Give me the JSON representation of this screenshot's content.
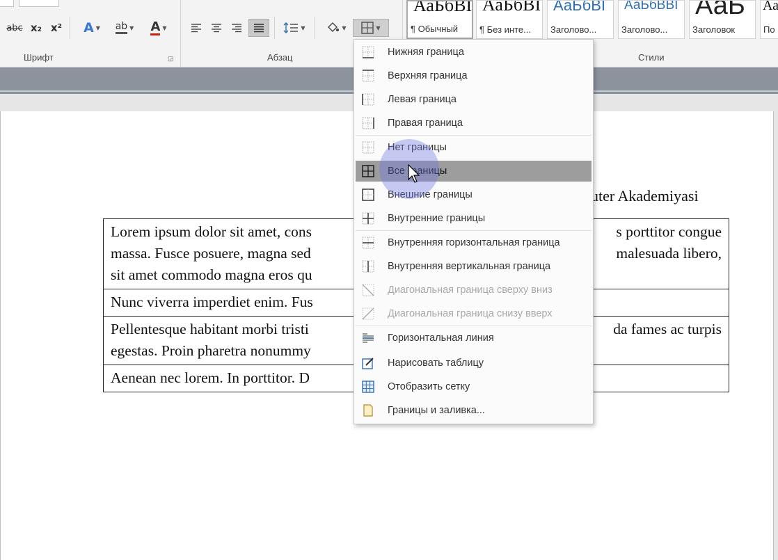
{
  "ribbon": {
    "font_group_label": "Шрифт",
    "paragraph_group_label": "Абзац",
    "styles_group_label": "Стили",
    "tools": {
      "strike": "abc",
      "subscript": "x₂",
      "superscript": "x²",
      "text_effects": "A",
      "highlight": "ab",
      "font_color": "A"
    }
  },
  "styles": [
    {
      "preview": "АаБбВІ",
      "name": "¶ Обычный"
    },
    {
      "preview": "АаБбВІ",
      "name": "¶ Без инте..."
    },
    {
      "preview": "АаБбВІ",
      "name": "Заголово..."
    },
    {
      "preview": "АаБбВВІ",
      "name": "Заголово..."
    },
    {
      "preview": "АаБ",
      "name": "Заголовок"
    },
    {
      "preview": "Аа",
      "name": "По"
    }
  ],
  "document": {
    "header_text": "uter Akademiyasi",
    "rows": [
      {
        "left": "Lorem ipsum dolor sit amet, cons",
        "right": "s porttitor congue",
        "left2": "massa. Fusce posuere, magna sed",
        "right2": "malesuada libero,",
        "left3": "sit amet commodo magna eros qu",
        "right3": ""
      },
      {
        "left": "Nunc viverra imperdiet enim. Fus",
        "right": ""
      },
      {
        "left": "Pellentesque habitant morbi tristi",
        "right": "da fames ac turpis",
        "left2": "egestas. Proin pharetra nonummy",
        "right2": ""
      },
      {
        "left": "Aenean nec lorem. In porttitor. D",
        "right": ""
      }
    ]
  },
  "border_menu": {
    "items": [
      {
        "label": "Нижняя граница",
        "icon": "border-bottom-icon"
      },
      {
        "label": "Верхняя граница",
        "icon": "border-top-icon"
      },
      {
        "label": "Левая граница",
        "icon": "border-left-icon"
      },
      {
        "label": "Правая граница",
        "icon": "border-right-icon"
      },
      {
        "label": "Нет границы",
        "icon": "border-none-icon"
      },
      {
        "label": "Все границы",
        "icon": "border-all-icon",
        "highlighted": true
      },
      {
        "label": "Внешние границы",
        "icon": "border-outside-icon"
      },
      {
        "label": "Внутренние границы",
        "icon": "border-inside-icon"
      },
      {
        "label": "Внутренняя горизонтальная граница",
        "icon": "border-inside-horizontal-icon"
      },
      {
        "label": "Внутренняя вертикальная граница",
        "icon": "border-inside-vertical-icon"
      },
      {
        "label": "Диагональная граница сверху вниз",
        "icon": "diagonal-down-icon",
        "disabled": true
      },
      {
        "label": "Диагональная граница снизу вверх",
        "icon": "diagonal-up-icon",
        "disabled": true
      },
      {
        "label": "Горизонтальная линия",
        "icon": "horizontal-line-icon"
      },
      {
        "label": "Нарисовать таблицу",
        "icon": "draw-table-icon"
      },
      {
        "label": "Отобразить сетку",
        "icon": "view-gridlines-icon"
      },
      {
        "label": "Границы и заливка...",
        "icon": "borders-shading-icon"
      }
    ]
  },
  "colors": {
    "highlight": "#9d9d9d",
    "heading_blue": "#2f6eb5",
    "band": "#8c939d",
    "cursor_halo": "#6e78e6"
  }
}
